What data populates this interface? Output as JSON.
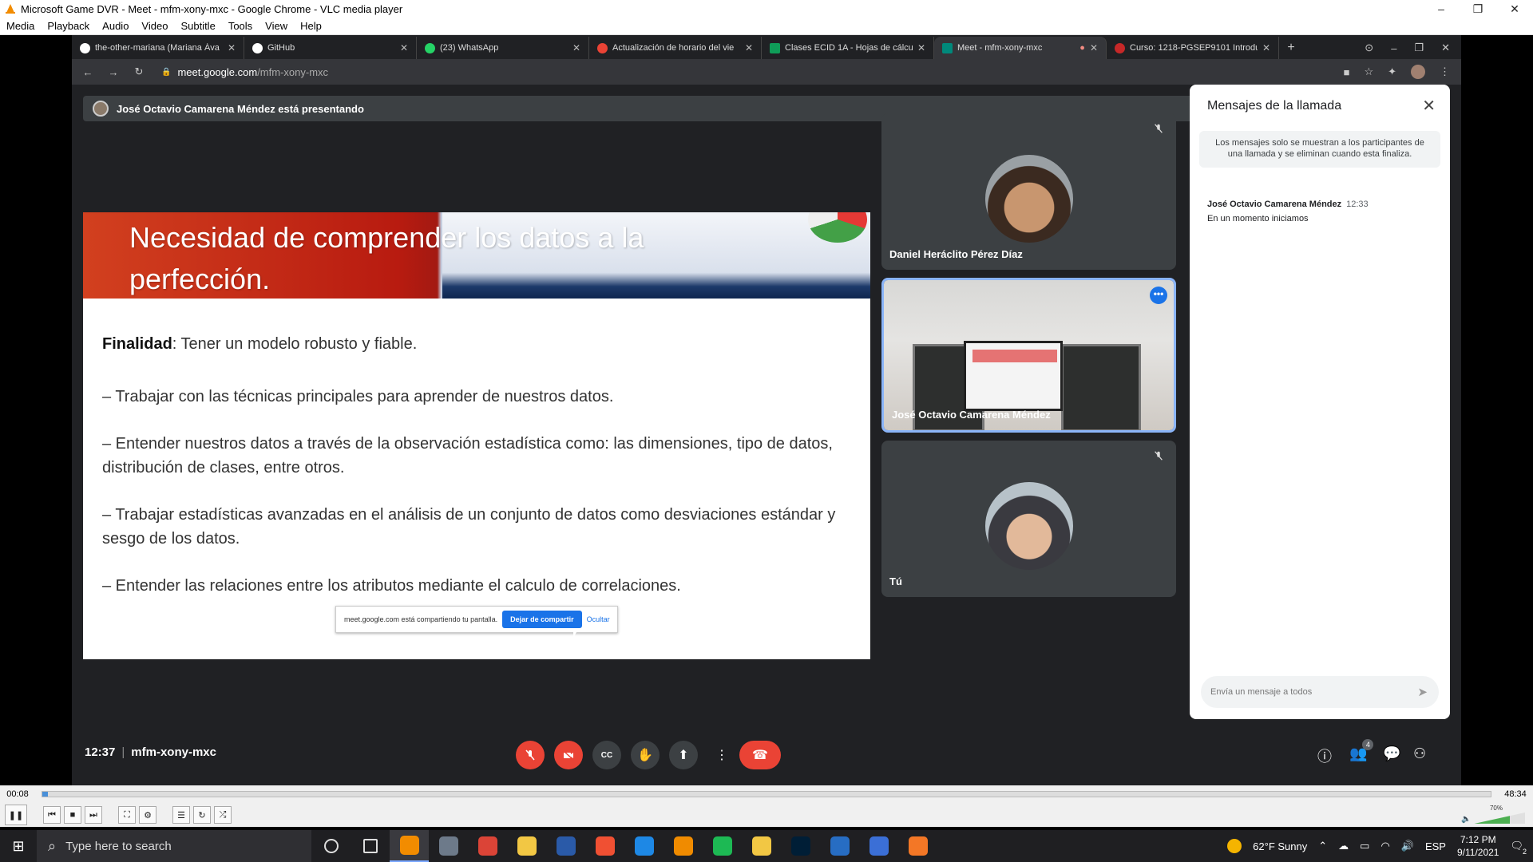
{
  "window": {
    "title": "Microsoft Game DVR - Meet - mfm-xony-mxc - Google Chrome - VLC media player",
    "controls": {
      "minimize": "–",
      "maximize": "❐",
      "close": "✕"
    }
  },
  "vlc_menu": [
    "Media",
    "Playback",
    "Audio",
    "Video",
    "Subtitle",
    "Tools",
    "View",
    "Help"
  ],
  "chrome": {
    "tabs": [
      {
        "label": "the-other-mariana (Mariana Áva",
        "icon_color": "#ffffff"
      },
      {
        "label": "GitHub",
        "icon_color": "#ffffff"
      },
      {
        "label": "(23) WhatsApp",
        "icon_color": "#25d366"
      },
      {
        "label": "Actualización de horario del vie",
        "icon_color": "#ea4335"
      },
      {
        "label": "Clases ECID 1A - Hojas de cálcul",
        "icon_color": "#0f9d58"
      },
      {
        "label": "Meet - mfm-xony-mxc",
        "icon_color": "#00897b",
        "recording": "●"
      },
      {
        "label": "Curso: 1218-PGSEP9101 Introdu",
        "icon_color": "#c62828"
      }
    ],
    "new_tab": "+",
    "url_host": "meet.google.com",
    "url_path": "/mfm-xony-mxc",
    "nav": {
      "back": "←",
      "forward": "→",
      "reload": "↻",
      "lock": "🔒"
    },
    "toolbar_icons": {
      "camera": "■",
      "star": "☆",
      "extensions": "✦",
      "menu": "⋮"
    },
    "tabstrip_icons": {
      "record": "⊙",
      "min": "–",
      "max": "❐",
      "close": "✕"
    }
  },
  "meet": {
    "presenting_banner": "José Octavio Camarena Méndez está presentando",
    "slide": {
      "title_line1": "Necesidad de comprender los datos a la",
      "title_line2": "perfección.",
      "finalidad_label": "Finalidad",
      "finalidad_text": ": Tener un modelo robusto y fiable.",
      "bullets": [
        "– Trabajar con las técnicas principales para aprender de nuestros datos.",
        "– Entender nuestros datos a través de la observación estadística como: las dimensiones, tipo de datos, distribución de clases, entre otros.",
        "– Trabajar estadísticas avanzadas en el análisis de un conjunto de datos como desviaciones estándar y sesgo de los datos.",
        "– Entender las relaciones entre los atributos mediante el calculo de correlaciones."
      ],
      "share_notice": "meet.google.com está compartiendo tu pantalla.",
      "stop_sharing": "Dejar de compartir",
      "hide": "Ocultar"
    },
    "participants": [
      {
        "name": "Daniel Heráclito Pérez Díaz",
        "muted": true
      },
      {
        "name": "José Octavio Camarena Méndez",
        "muted": false,
        "active": true
      },
      {
        "name": "Tú",
        "muted": true
      }
    ],
    "mute_icon": "🎤̸",
    "more_icon": "•••",
    "chat": {
      "title": "Mensajes de la llamada",
      "close": "✕",
      "info": "Los mensajes solo se muestran a los participantes de una llamada y se eliminan cuando esta finaliza.",
      "messages": [
        {
          "sender": "José Octavio Camarena Méndez",
          "time": "12:33",
          "text": "En un momento iniciamos"
        }
      ],
      "input_placeholder": "Envía un mensaje a todos",
      "send": "➤"
    },
    "bottom": {
      "time": "12:37",
      "meeting_code": "mfm-xony-mxc",
      "participants_count": "4",
      "icons": {
        "mic": "🎙",
        "cam": "📷",
        "cc": "CC",
        "hand": "✋",
        "present": "⬆",
        "more": "⋮",
        "end": "☎",
        "info": "ⓘ",
        "people": "👥",
        "chat": "💬",
        "activities": "⚇"
      }
    }
  },
  "vlc_controls": {
    "elapsed": "00:08",
    "total": "48:34",
    "progress": 0.003,
    "volume_label": "70%",
    "volume": 0.7,
    "buttons": {
      "pause": "❚❚",
      "prev": "⏮",
      "stop": "■",
      "next": "⏭",
      "fullscreen": "⛶",
      "extended": "⚙",
      "playlist": "☰",
      "loop": "↻",
      "random": "⤮"
    }
  },
  "taskbar": {
    "search_placeholder": "Type here to search",
    "start_icon": "⊞",
    "search_icon": "⌕",
    "weather": "62°F  Sunny",
    "lang": "ESP",
    "time": "7:12 PM",
    "date": "9/11/2021",
    "notif_count": "2",
    "apps": [
      {
        "name": "cortana-icon",
        "color": "#1f1f22"
      },
      {
        "name": "task-view-icon",
        "color": "#1f1f22"
      },
      {
        "name": "vlc-icon",
        "color": "#f28c00"
      },
      {
        "name": "mail-icon",
        "color": "#6d7a8a"
      },
      {
        "name": "chrome-icon",
        "color": "#db4437"
      },
      {
        "name": "file-explorer-icon",
        "color": "#f2c744"
      },
      {
        "name": "powershell-icon",
        "color": "#2a5aa8"
      },
      {
        "name": "git-icon",
        "color": "#f05033"
      },
      {
        "name": "vscode-icon",
        "color": "#1e88e5"
      },
      {
        "name": "sublime-icon",
        "color": "#f08b00"
      },
      {
        "name": "spotify-icon",
        "color": "#1db954"
      },
      {
        "name": "app-icon",
        "color": "#f2c744"
      },
      {
        "name": "photoshop-icon",
        "color": "#001e36"
      },
      {
        "name": "r-icon",
        "color": "#276dc3"
      },
      {
        "name": "app2-icon",
        "color": "#3b6fd6"
      },
      {
        "name": "jupyter-icon",
        "color": "#f37726"
      }
    ]
  }
}
